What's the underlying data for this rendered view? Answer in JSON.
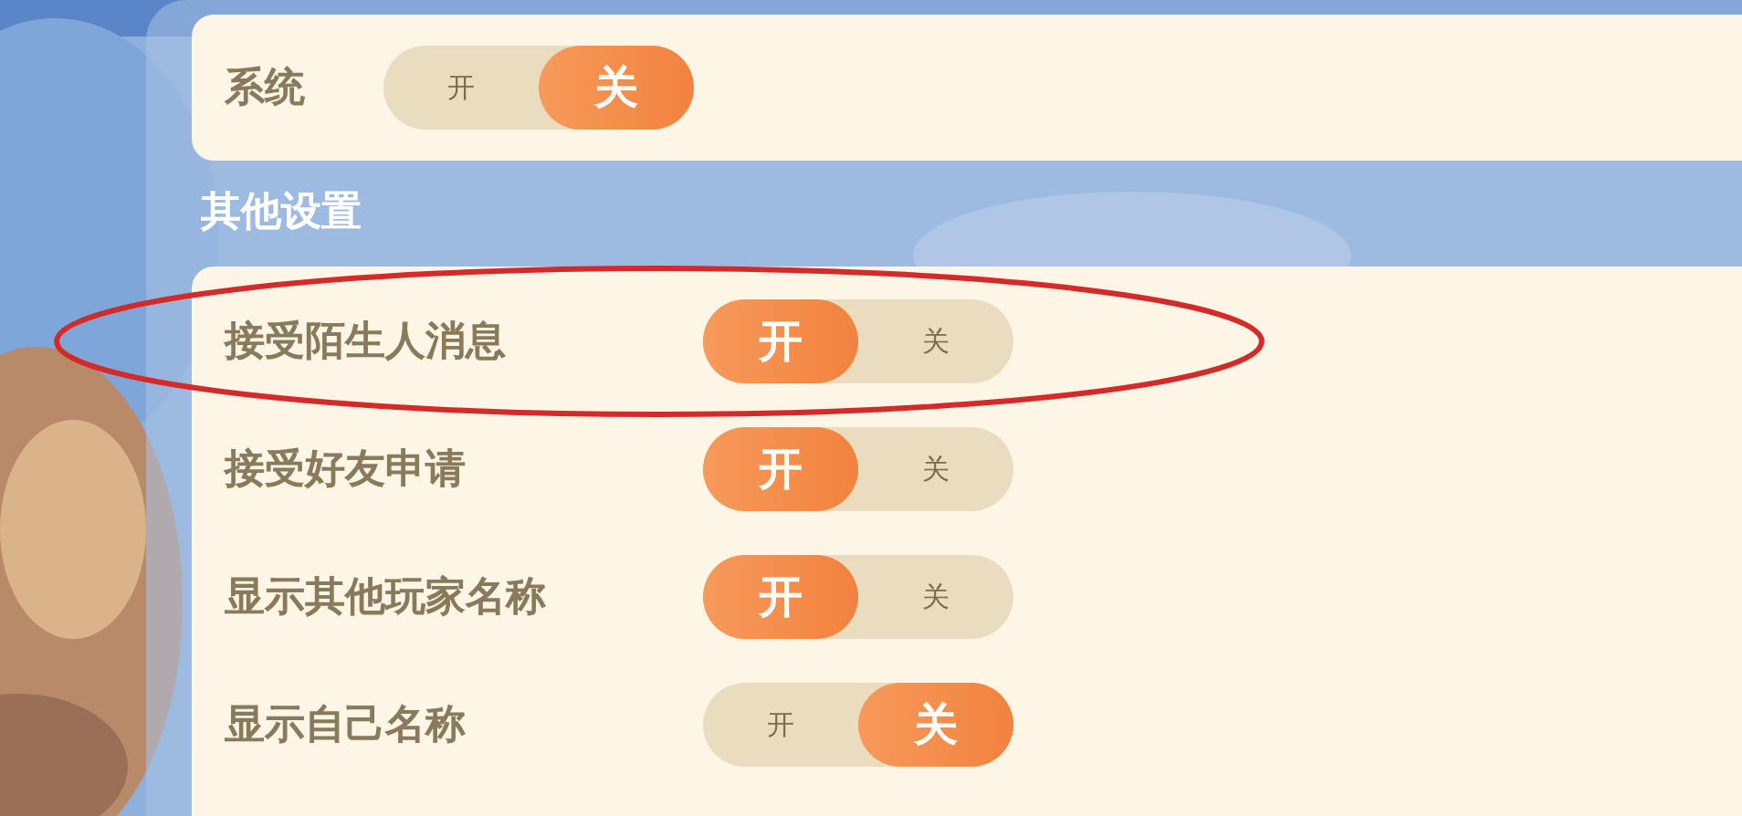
{
  "top_card": {
    "rows": [
      {
        "label": "系统",
        "options": [
          {
            "label": "开",
            "selected": false
          },
          {
            "label": "关",
            "selected": true
          }
        ]
      }
    ]
  },
  "section": {
    "title": "其他设置",
    "rows": [
      {
        "label": "接受陌生人消息",
        "options": [
          {
            "label": "开",
            "selected": true
          },
          {
            "label": "关",
            "selected": false
          }
        ]
      },
      {
        "label": "接受好友申请",
        "options": [
          {
            "label": "开",
            "selected": true
          },
          {
            "label": "关",
            "selected": false
          }
        ]
      },
      {
        "label": "显示其他玩家名称",
        "options": [
          {
            "label": "开",
            "selected": true
          },
          {
            "label": "关",
            "selected": false
          }
        ]
      },
      {
        "label": "显示自己名称",
        "options": [
          {
            "label": "开",
            "selected": false
          },
          {
            "label": "关",
            "selected": true
          }
        ]
      }
    ]
  }
}
